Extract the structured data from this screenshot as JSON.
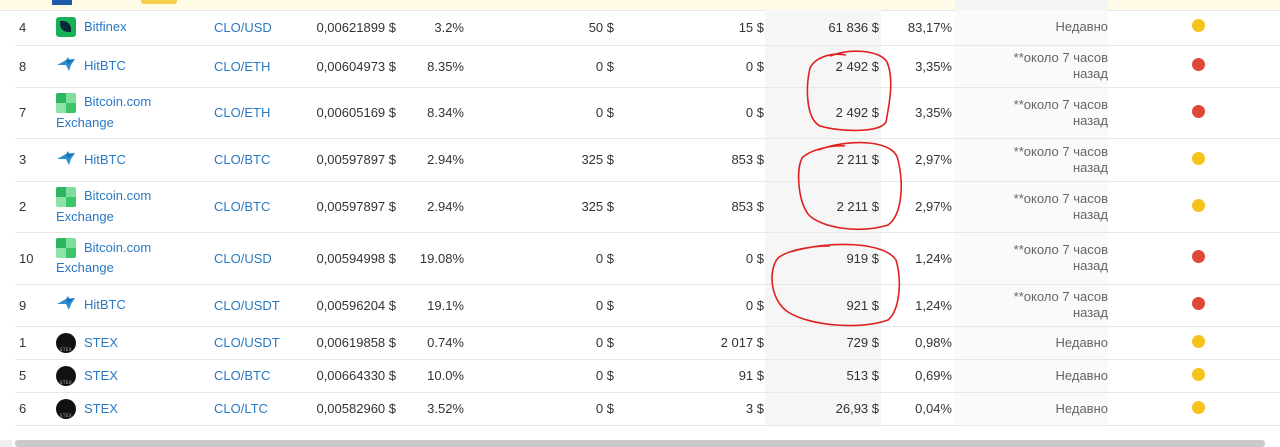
{
  "colors": {
    "link": "#2a79c2",
    "status_yellow": "#f6c21c",
    "status_red": "#e0473a",
    "annotation": "#e02020"
  },
  "rows": [
    {
      "rank": "4",
      "exchange": "Bitfinex",
      "logo": "bitfinex",
      "pair": "CLO/USD",
      "price": "0,00621899 $",
      "change": "3.2%",
      "depth_minus": "50 $",
      "depth_plus": "15 $",
      "volume": "61 836 $",
      "volume_pct": "83,17%",
      "updated": "Недавно",
      "updated2": "",
      "status": "yellow",
      "multiline": false,
      "h": 35
    },
    {
      "rank": "8",
      "exchange": "HitBTC",
      "logo": "hitbtc",
      "pair": "CLO/ETH",
      "price": "0,00604973 $",
      "change": "8.35%",
      "depth_minus": "0 $",
      "depth_plus": "0 $",
      "volume": "2 492 $",
      "volume_pct": "3,35%",
      "updated": "**около 7 часов",
      "updated2": "назад",
      "status": "red",
      "multiline": false,
      "h": 42
    },
    {
      "rank": "7",
      "exchange": "Bitcoin.com",
      "exchange2": "Exchange",
      "logo": "bitcoincom",
      "pair": "CLO/ETH",
      "price": "0,00605169 $",
      "change": "8.34%",
      "depth_minus": "0 $",
      "depth_plus": "0 $",
      "volume": "2 492 $",
      "volume_pct": "3,35%",
      "updated": "**около 7 часов",
      "updated2": "назад",
      "status": "red",
      "multiline": true,
      "h": 51
    },
    {
      "rank": "3",
      "exchange": "HitBTC",
      "logo": "hitbtc",
      "pair": "CLO/BTC",
      "price": "0,00597897 $",
      "change": "2.94%",
      "depth_minus": "325 $",
      "depth_plus": "853 $",
      "volume": "2 211 $",
      "volume_pct": "2,97%",
      "updated": "**около 7 часов",
      "updated2": "назад",
      "status": "yellow",
      "multiline": false,
      "h": 43
    },
    {
      "rank": "2",
      "exchange": "Bitcoin.com",
      "exchange2": "Exchange",
      "logo": "bitcoincom",
      "pair": "CLO/BTC",
      "price": "0,00597897 $",
      "change": "2.94%",
      "depth_minus": "325 $",
      "depth_plus": "853 $",
      "volume": "2 211 $",
      "volume_pct": "2,97%",
      "updated": "**около 7 часов",
      "updated2": "назад",
      "status": "yellow",
      "multiline": true,
      "h": 51
    },
    {
      "rank": "10",
      "exchange": "Bitcoin.com",
      "exchange2": "Exchange",
      "logo": "bitcoincom",
      "pair": "CLO/USD",
      "price": "0,00594998 $",
      "change": "19.08%",
      "depth_minus": "0 $",
      "depth_plus": "0 $",
      "volume": "919 $",
      "volume_pct": "1,24%",
      "updated": "**около 7 часов",
      "updated2": "назад",
      "status": "red",
      "multiline": true,
      "h": 52
    },
    {
      "rank": "9",
      "exchange": "HitBTC",
      "logo": "hitbtc",
      "pair": "CLO/USDT",
      "price": "0,00596204 $",
      "change": "19.1%",
      "depth_minus": "0 $",
      "depth_plus": "0 $",
      "volume": "921 $",
      "volume_pct": "1,24%",
      "updated": "**около 7 часов",
      "updated2": "назад",
      "status": "red",
      "multiline": false,
      "h": 42
    },
    {
      "rank": "1",
      "exchange": "STEX",
      "logo": "stex",
      "pair": "CLO/USDT",
      "price": "0,00619858 $",
      "change": "0.74%",
      "depth_minus": "0 $",
      "depth_plus": "2 017 $",
      "volume": "729 $",
      "volume_pct": "0,98%",
      "updated": "Недавно",
      "updated2": "",
      "status": "yellow",
      "multiline": false,
      "h": 33
    },
    {
      "rank": "5",
      "exchange": "STEX",
      "logo": "stex",
      "pair": "CLO/BTC",
      "price": "0,00664330 $",
      "change": "10.0%",
      "depth_minus": "0 $",
      "depth_plus": "91 $",
      "volume": "513 $",
      "volume_pct": "0,69%",
      "updated": "Недавно",
      "updated2": "",
      "status": "yellow",
      "multiline": false,
      "h": 33
    },
    {
      "rank": "6",
      "exchange": "STEX",
      "logo": "stex",
      "pair": "CLO/LTC",
      "price": "0,00582960 $",
      "change": "3.52%",
      "depth_minus": "0 $",
      "depth_plus": "3 $",
      "volume": "26,93 $",
      "volume_pct": "0,04%",
      "updated": "Недавно",
      "updated2": "",
      "status": "yellow",
      "multiline": false,
      "h": 33
    }
  ]
}
